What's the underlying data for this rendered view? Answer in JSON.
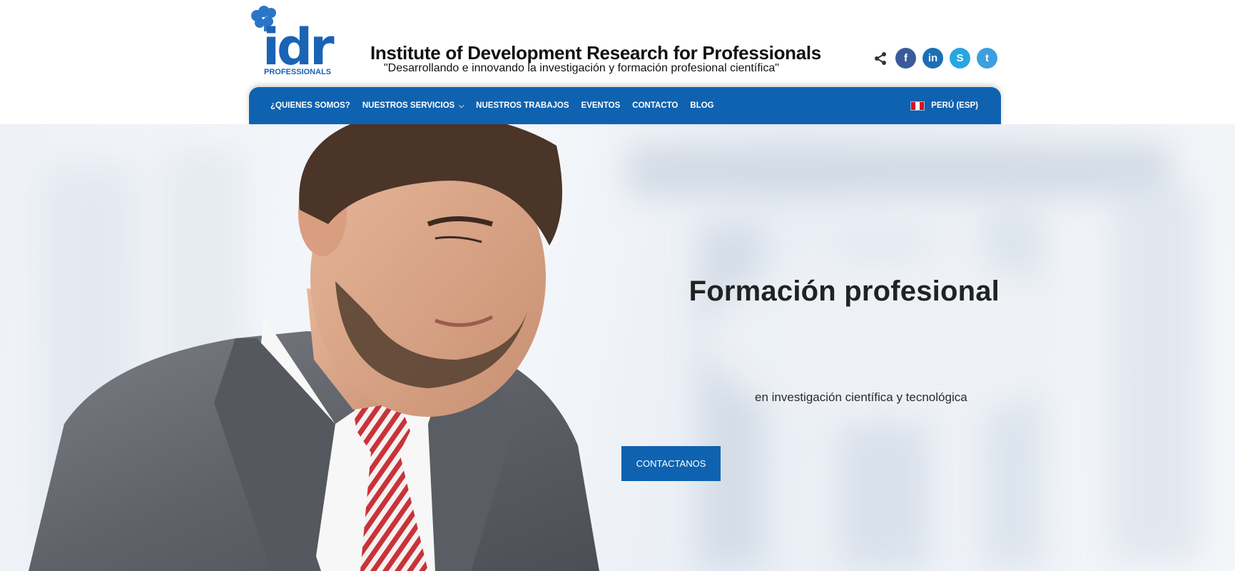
{
  "header": {
    "logo_text": "idr",
    "logo_subtext": "PROFESSIONALS",
    "title": "Institute of Development Research for Professionals",
    "tagline": "\"Desarrollando e innovando la investigación y formación profesional científica\""
  },
  "social": [
    {
      "name": "share-icon"
    },
    {
      "name": "facebook-icon",
      "glyph": "f",
      "color": "#3b5a9a"
    },
    {
      "name": "linkedin-icon",
      "glyph": "in",
      "color": "#1a6fb5"
    },
    {
      "name": "skype-icon",
      "glyph": "S",
      "color": "#27a7e2"
    },
    {
      "name": "twitter-icon",
      "glyph": "t",
      "color": "#3d9fe0"
    }
  ],
  "nav": {
    "items": [
      {
        "label": "¿QUIENES SOMOS?"
      },
      {
        "label": "NUESTROS SERVICIOS",
        "has_dropdown": true
      },
      {
        "label": "NUESTROS TRABAJOS"
      },
      {
        "label": "EVENTOS"
      },
      {
        "label": "CONTACTO"
      },
      {
        "label": "BLOG"
      }
    ],
    "language": "PERÚ (ESP)",
    "flag_colors": [
      "#d91023",
      "#ffffff",
      "#d91023"
    ]
  },
  "hero": {
    "title": "Formación profesional",
    "subtitle": "en investigación científica y tecnológica",
    "cta_label": "CONTACTANOS"
  },
  "colors": {
    "brand_blue": "#0f62b0",
    "text_dark": "#222222"
  }
}
